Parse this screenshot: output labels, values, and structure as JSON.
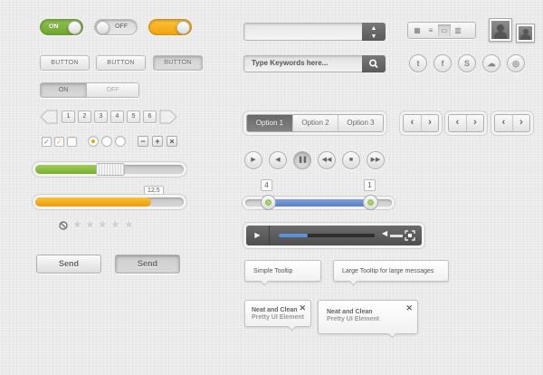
{
  "toggles": [
    {
      "label": "ON",
      "state": "on",
      "color": "#7ab13a"
    },
    {
      "label": "OFF",
      "state": "off",
      "color": "#d9d9d9"
    },
    {
      "label": "",
      "state": "on",
      "color": "#f5a90f"
    }
  ],
  "buttons": {
    "b1": "BUTTON",
    "b2": "BUTTON",
    "b3": "BUTTON"
  },
  "segmented_onoff": {
    "on_label": "ON",
    "off_label": "OFF"
  },
  "pagination": {
    "pages": [
      "1",
      "2",
      "3",
      "4",
      "5",
      "6"
    ]
  },
  "controls": {
    "plus": "+",
    "minus": "−",
    "close": "×"
  },
  "progress": {
    "green_value": 0.43,
    "orange_value": 0.78,
    "orange_tooltip": "12.5"
  },
  "rating": {
    "max": 5,
    "value": 0
  },
  "send_buttons": {
    "normal": "Send",
    "pressed": "Send"
  },
  "select": {
    "value": ""
  },
  "search": {
    "placeholder": "Type Keywords here...",
    "value": ""
  },
  "social": [
    {
      "name": "twitter-icon",
      "glyph": "t"
    },
    {
      "name": "facebook-icon",
      "glyph": "f"
    },
    {
      "name": "skype-icon",
      "glyph": "S"
    },
    {
      "name": "cloud-icon",
      "glyph": "☁"
    },
    {
      "name": "dribbble-icon",
      "glyph": "◎"
    }
  ],
  "options": {
    "opt1": "Option 1",
    "opt2": "Option 2",
    "opt3": "Option 3",
    "selected": "Option 1"
  },
  "range": {
    "low": "4",
    "high": "1"
  },
  "player": {
    "progress": 0.3,
    "volume": 0.7
  },
  "tooltips": {
    "simple": "Simple Tooltip",
    "large": "Large Tooltip for large messages",
    "neat1_title": "Neat and Clean",
    "neat1_sub": "Pretty UI Element",
    "neat2_title": "Neat and Clean",
    "neat2_sub": "Pretty UI Element"
  },
  "colors": {
    "green": "#7ab13a",
    "orange": "#f5a90f",
    "blue": "#5f8fd6",
    "dark": "#5f5f5f"
  }
}
